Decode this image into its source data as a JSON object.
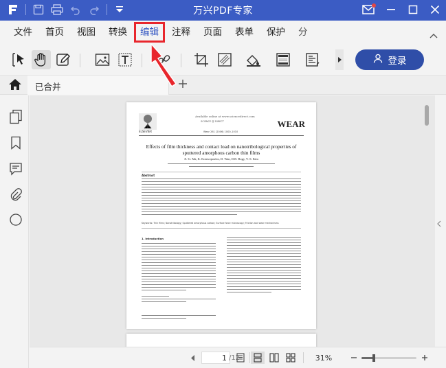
{
  "window": {
    "title": "万兴PDF专家",
    "colors": {
      "accent": "#3b5cc4",
      "login": "#2f4ea8",
      "highlight": "#e8262c"
    }
  },
  "menu": {
    "items": [
      {
        "label": "文件"
      },
      {
        "label": "首页"
      },
      {
        "label": "视图"
      },
      {
        "label": "转换"
      },
      {
        "label": "编辑",
        "active": true
      },
      {
        "label": "注释"
      },
      {
        "label": "页面"
      },
      {
        "label": "表单"
      },
      {
        "label": "保护"
      },
      {
        "label": "分"
      }
    ]
  },
  "toolbar": {
    "tools": [
      "select-arrow-icon",
      "hand-icon",
      "edit-text-icon",
      "image-icon",
      "text-box-icon",
      "link-icon",
      "crop-icon",
      "watermark-icon",
      "background-icon",
      "header-footer-icon",
      "bates-icon"
    ],
    "login_label": "登录"
  },
  "tabs": [
    {
      "label": "已合并"
    }
  ],
  "sidebar": {
    "icons": [
      "pages-icon",
      "bookmark-icon",
      "comment-icon",
      "attachment-icon",
      "search-icon"
    ]
  },
  "document": {
    "journal_line": "Available online at www.sciencedirect.com",
    "publisher": "SCIENCE @ DIRECT",
    "logo": "WEAR",
    "ref": "Wear 261 (2006) 1000–1010",
    "elsevier": "ELSEVIER",
    "title": "Effects of film thickness and contact load on nanotribological properties of sputtered amorphous carbon thin films",
    "authors": "X.-G. Ma, K. Komvopoulos, D. Wan, D.B. Bogy, Y.-S. Kim",
    "abstract_heading": "Abstract",
    "keywords": "Keywords: Thin films; Nanotribology; Sputtered amorphous carbon; Surface force microscopy; Friction and wear mechanisms",
    "intro_heading": "1. Introduction"
  },
  "statusbar": {
    "page_current": "1",
    "page_total": "/12",
    "zoom": "31%",
    "zoom_level": 0.22
  }
}
